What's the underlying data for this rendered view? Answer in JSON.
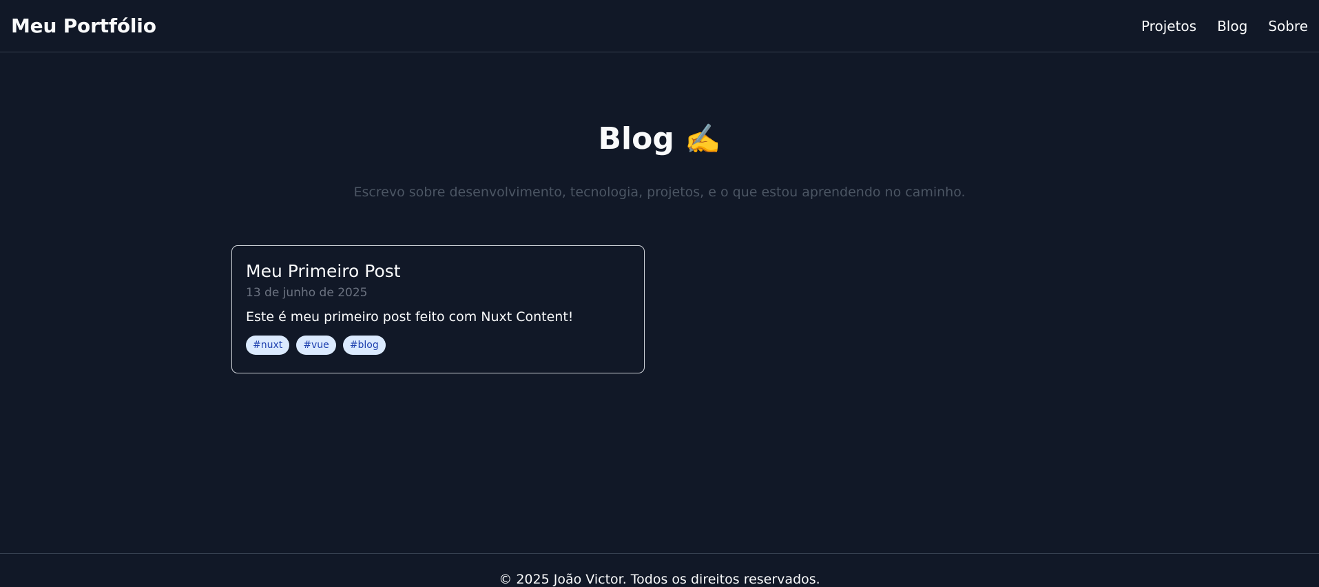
{
  "header": {
    "brand": "Meu Portfólio",
    "nav": [
      {
        "label": "Projetos"
      },
      {
        "label": "Blog"
      },
      {
        "label": "Sobre"
      }
    ]
  },
  "hero": {
    "title": "Blog",
    "emoji": "✍️",
    "subtitle": "Escrevo sobre desenvolvimento, tecnologia, projetos, e o que estou aprendendo no caminho."
  },
  "posts": [
    {
      "title": "Meu Primeiro Post",
      "date": "13 de junho de 2025",
      "excerpt": "Este é meu primeiro post feito com Nuxt Content!",
      "tags": [
        "#nuxt",
        "#vue",
        "#blog"
      ]
    }
  ],
  "footer": {
    "text": "© 2025 João Victor. Todos os direitos reservados."
  },
  "colors": {
    "background": "#111827",
    "border": "#374151",
    "card_border": "#d1d5db",
    "tag_bg": "#dbeafe",
    "tag_text": "#1e40af"
  }
}
